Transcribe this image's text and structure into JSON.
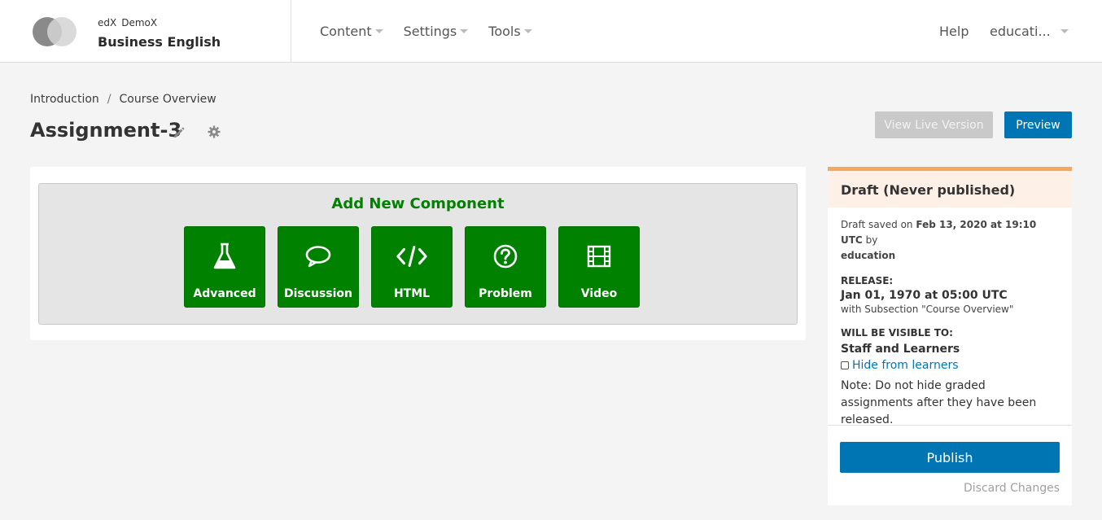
{
  "header": {
    "org": "edX",
    "run": "DemoX",
    "course_name": "Business English",
    "nav": [
      "Content",
      "Settings",
      "Tools"
    ],
    "help": "Help",
    "user": "educati..."
  },
  "breadcrumb": [
    "Introduction",
    "Course Overview"
  ],
  "page_title": "Assignment-3",
  "actions": {
    "view_live": "View Live Version",
    "preview": "Preview"
  },
  "add_component": {
    "title": "Add New Component",
    "buttons": [
      {
        "label": "Advanced",
        "icon": "flask-icon"
      },
      {
        "label": "Discussion",
        "icon": "speech-bubble-icon"
      },
      {
        "label": "HTML",
        "icon": "code-icon"
      },
      {
        "label": "Problem",
        "icon": "question-circle-icon"
      },
      {
        "label": "Video",
        "icon": "film-icon"
      }
    ]
  },
  "sidebar": {
    "status": "Draft (Never published)",
    "saved_prefix": "Draft saved on",
    "saved_date": "Feb 13, 2020 at 19:10 UTC",
    "saved_by_prefix": "by",
    "saved_by": "education",
    "release_label": "RELEASE:",
    "release_date": "Jan 01, 1970 at 05:00 UTC",
    "release_with": "with Subsection \"Course Overview\"",
    "visible_label": "WILL BE VISIBLE TO:",
    "visible_to": "Staff and Learners",
    "hide_link": "Hide from learners",
    "note": "Note: Do not hide graded assignments after they have been released.",
    "publish": "Publish",
    "discard": "Discard Changes"
  },
  "colors": {
    "green": "#008100",
    "blue": "#0075b4",
    "draft_accent": "#f5a85d"
  }
}
